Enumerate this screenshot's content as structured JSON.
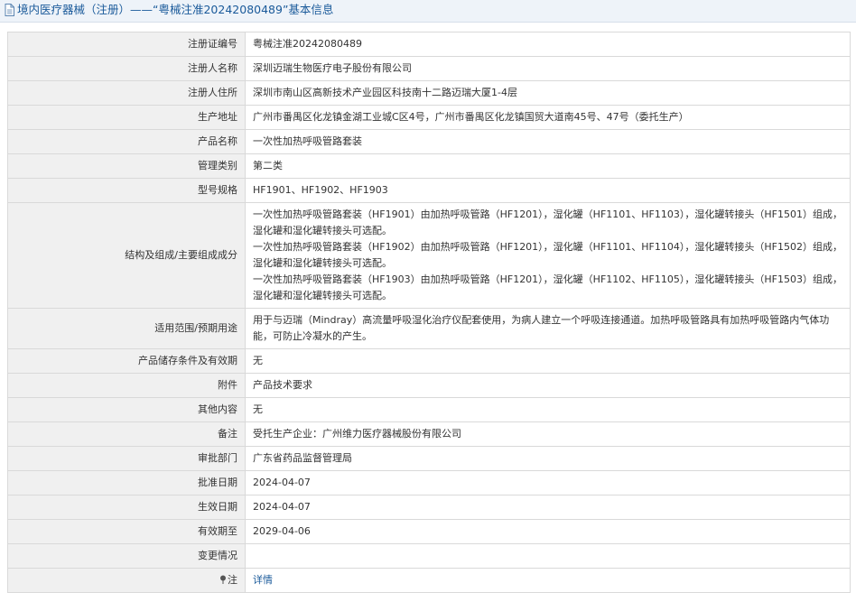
{
  "header": {
    "title": "境内医疗器械（注册）——“粤械注准20242080489”基本信息",
    "icon": "document-icon"
  },
  "fields": [
    {
      "label": "注册证编号",
      "value": "粤械注准20242080489"
    },
    {
      "label": "注册人名称",
      "value": "深圳迈瑞生物医疗电子股份有限公司"
    },
    {
      "label": "注册人住所",
      "value": "深圳市南山区高新技术产业园区科技南十二路迈瑞大厦1-4层"
    },
    {
      "label": "生产地址",
      "value": "广州市番禺区化龙镇金湖工业城C区4号，广州市番禺区化龙镇国贸大道南45号、47号（委托生产）"
    },
    {
      "label": "产品名称",
      "value": "一次性加热呼吸管路套装"
    },
    {
      "label": "管理类别",
      "value": "第二类"
    },
    {
      "label": "型号规格",
      "value": "HF1901、HF1902、HF1903"
    },
    {
      "label": "结构及组成/主要组成成分",
      "value": "一次性加热呼吸管路套装（HF1901）由加热呼吸管路（HF1201），湿化罐（HF1101、HF1103），湿化罐转接头（HF1501）组成，湿化罐和湿化罐转接头可选配。\n一次性加热呼吸管路套装（HF1902）由加热呼吸管路（HF1201），湿化罐（HF1101、HF1104），湿化罐转接头（HF1502）组成，湿化罐和湿化罐转接头可选配。\n一次性加热呼吸管路套装（HF1903）由加热呼吸管路（HF1201），湿化罐（HF1102、HF1105），湿化罐转接头（HF1503）组成，湿化罐和湿化罐转接头可选配。"
    },
    {
      "label": "适用范围/预期用途",
      "value": "用于与迈瑞（Mindray）高流量呼吸湿化治疗仪配套使用，为病人建立一个呼吸连接通道。加热呼吸管路具有加热呼吸管路内气体功能，可防止冷凝水的产生。"
    },
    {
      "label": "产品储存条件及有效期",
      "value": "无"
    },
    {
      "label": "附件",
      "value": "产品技术要求"
    },
    {
      "label": "其他内容",
      "value": "无"
    },
    {
      "label": "备注",
      "value": "受托生产企业：广州维力医疗器械股份有限公司"
    },
    {
      "label": "审批部门",
      "value": "广东省药品监督管理局"
    },
    {
      "label": "批准日期",
      "value": "2024-04-07"
    },
    {
      "label": "生效日期",
      "value": "2024-04-07"
    },
    {
      "label": "有效期至",
      "value": "2029-04-06"
    },
    {
      "label": "变更情况",
      "value": ""
    }
  ],
  "note_row": {
    "label": "注",
    "icon": "pin-icon",
    "link_label": "详情"
  },
  "colors": {
    "header_bg": "#eef3f9",
    "title_text": "#1a5a9a",
    "label_bg": "#f0f0f0",
    "border": "#d9d9d9",
    "link": "#1a5a9a"
  }
}
